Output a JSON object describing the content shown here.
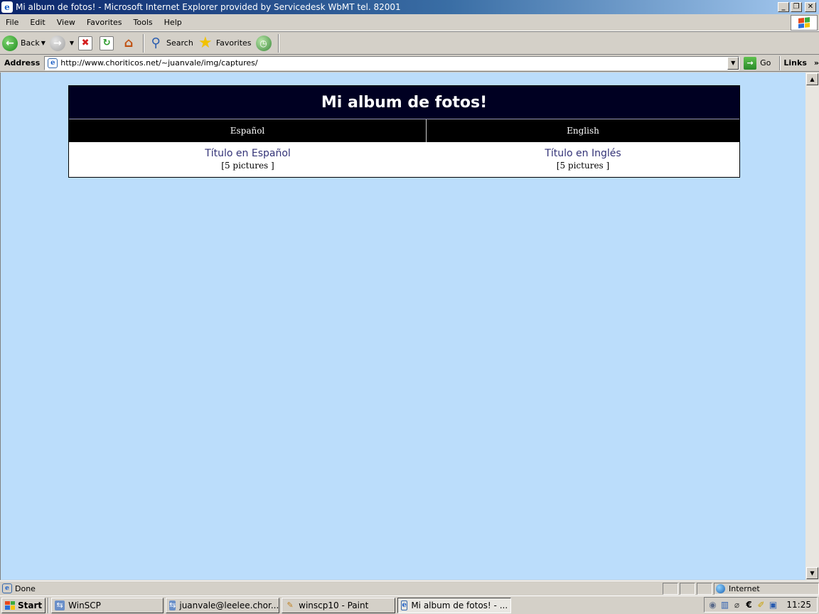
{
  "window": {
    "title": "Mi album de fotos! - Microsoft Internet Explorer provided by Servicedesk WbMT tel. 82001",
    "controls": {
      "minimize": "_",
      "restore": "❐",
      "close": "✕"
    }
  },
  "menubar": {
    "items": [
      "File",
      "Edit",
      "View",
      "Favorites",
      "Tools",
      "Help"
    ]
  },
  "toolbar": {
    "back_label": "Back",
    "search_label": "Search",
    "favorites_label": "Favorites"
  },
  "address": {
    "label": "Address",
    "url": "http://www.choriticos.net/~juanvale/img/captures/",
    "go_label": "Go",
    "links_label": "Links"
  },
  "page": {
    "heading": "Mi album de fotos!",
    "languages": [
      "Español",
      "English"
    ],
    "albums": [
      {
        "title": "Título en Español",
        "count": "[5 pictures ]"
      },
      {
        "title": "Título en Inglés",
        "count": "[5 pictures ]"
      }
    ],
    "background_color": "#bbddfb",
    "header_color": "#000022",
    "link_color": "#333377"
  },
  "status": {
    "text": "Done",
    "zone": "Internet"
  },
  "taskbar": {
    "start_label": "Start",
    "tasks": [
      {
        "label": "WinSCP",
        "icon": "winscp-icon"
      },
      {
        "label": "juanvale@leelee.chor...",
        "icon": "winscp-icon"
      },
      {
        "label": "winscp10 - Paint",
        "icon": "paint-icon"
      },
      {
        "label": "Mi album de fotos! - ...",
        "icon": "ie-icon",
        "active": true
      }
    ],
    "clock": "11:25"
  }
}
